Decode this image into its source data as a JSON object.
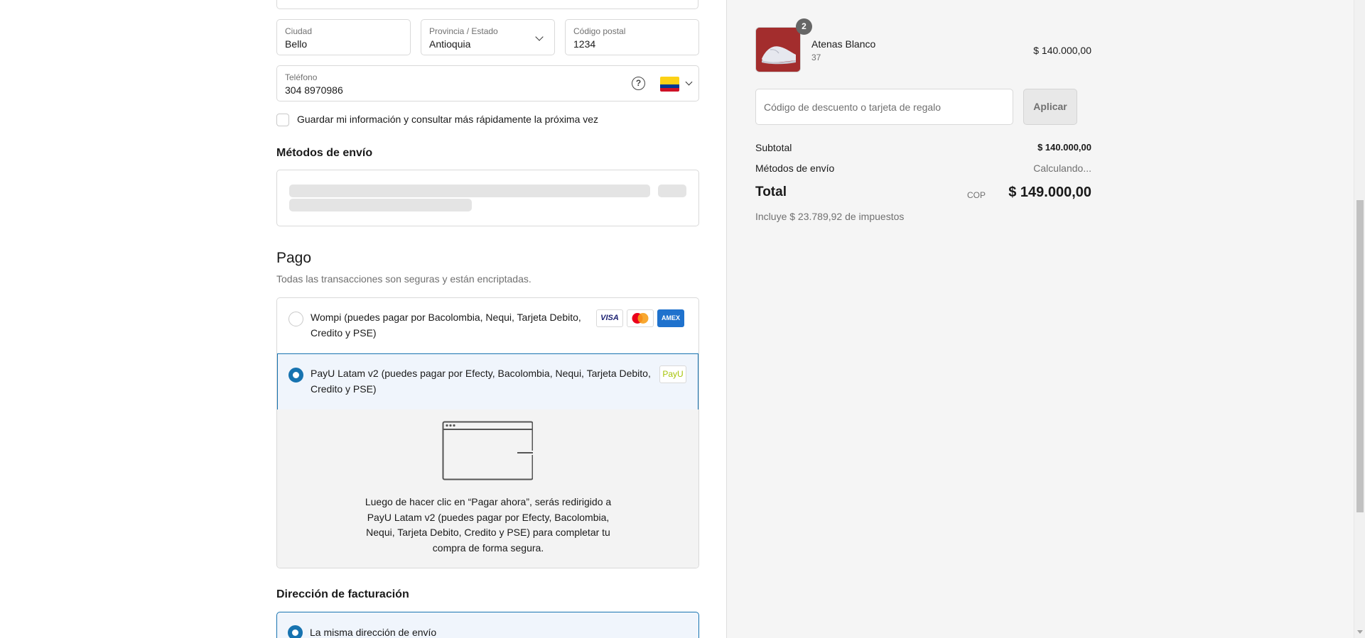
{
  "shipping_form": {
    "city": {
      "label": "Ciudad",
      "value": "Bello"
    },
    "state": {
      "label": "Provincia / Estado",
      "value": "Antioquia"
    },
    "postal": {
      "label": "Código postal",
      "value": "1234"
    },
    "phone": {
      "label": "Teléfono",
      "value": "304 8970986",
      "help_icon": "question-circle-icon",
      "flag": "colombia-flag-icon"
    },
    "save_info_label": "Guardar mi información y consultar más rápidamente la próxima vez"
  },
  "shipping_methods": {
    "title": "Métodos de envío"
  },
  "payment": {
    "title": "Pago",
    "subtitle": "Todas las transacciones son seguras y están encriptadas.",
    "options": [
      {
        "label": "Wompi (puedes pagar por Bacolombia, Nequi, Tarjeta Debito, Credito y PSE)",
        "selected": false,
        "cards": [
          "VISA",
          "mastercard",
          "AMEX"
        ]
      },
      {
        "label": "PayU Latam v2 (puedes pagar por Efecty, Bacolombia, Nequi, Tarjeta Debito, Credito y PSE)",
        "selected": true,
        "logo": "PayU"
      }
    ],
    "redirect_info": "Luego de hacer clic en “Pagar ahora”, serás redirigido a PayU Latam v2 (puedes pagar por Efecty, Bacolombia, Nequi, Tarjeta Debito, Credito y PSE) para completar tu compra de forma segura."
  },
  "billing": {
    "title": "Dirección de facturación",
    "same_address_label": "La misma dirección de envío"
  },
  "summary": {
    "item": {
      "name": "Atenas Blanco",
      "variant": "37",
      "price": "$ 140.000,00",
      "quantity": "2"
    },
    "discount": {
      "placeholder": "Código de descuento o tarjeta de regalo",
      "apply_label": "Aplicar"
    },
    "subtotal": {
      "label": "Subtotal",
      "value": "$ 140.000,00"
    },
    "shipping": {
      "label": "Métodos de envío",
      "value": "Calculando..."
    },
    "total": {
      "label": "Total",
      "currency": "COP",
      "value": "$ 149.000,00"
    },
    "taxes_note": "Incluye $ 23.789,92 de impuestos"
  },
  "colors": {
    "accent": "#1773b0",
    "selected_bg": "#f0f5fc",
    "panel_bg": "#f5f5f5"
  }
}
